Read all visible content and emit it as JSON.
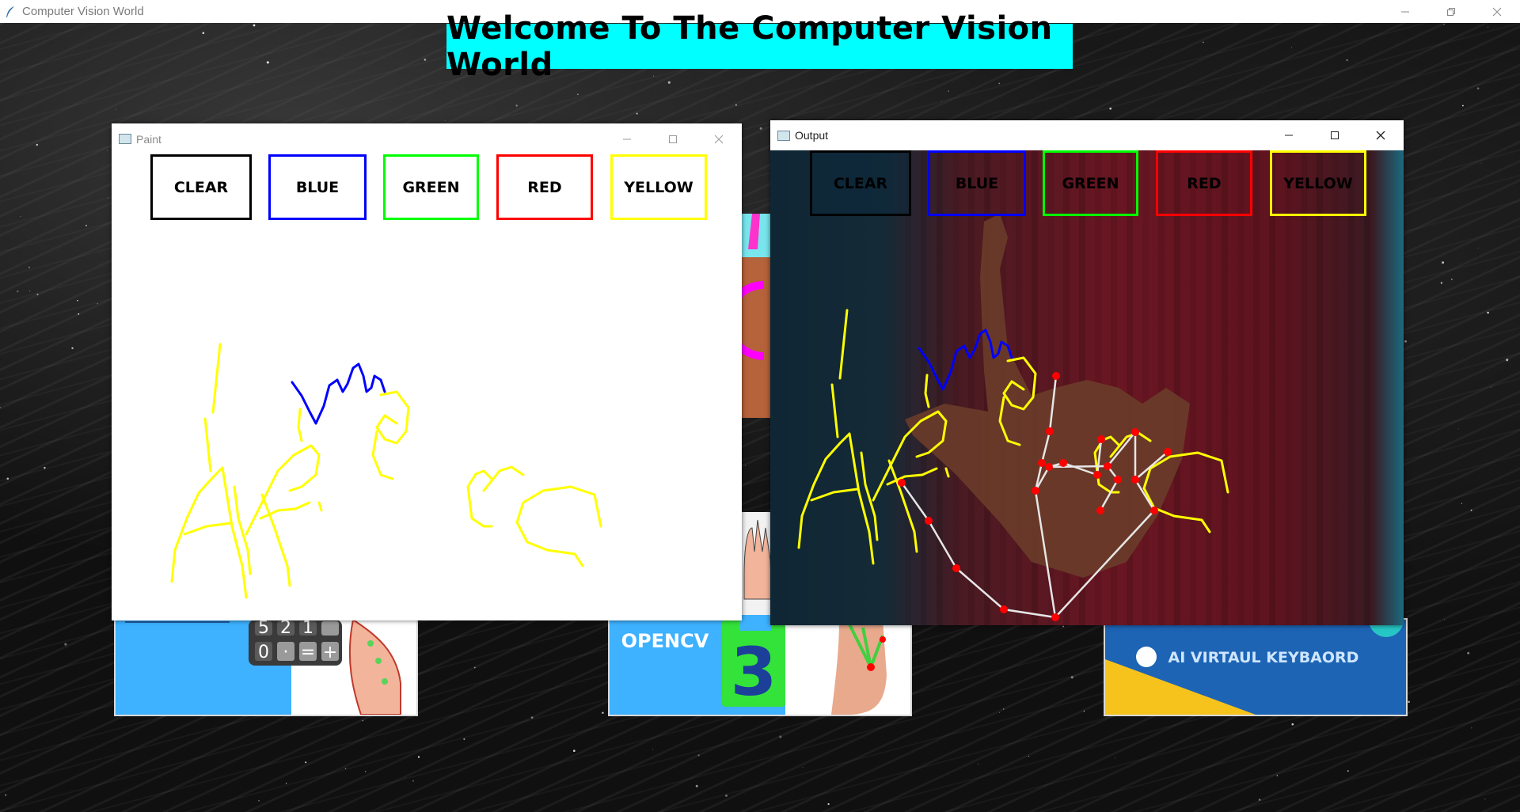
{
  "main_window": {
    "title": "Computer Vision World"
  },
  "banner": {
    "text": "Welcome To The Computer Vision World"
  },
  "paint_window": {
    "title": "Paint",
    "buttons": [
      {
        "label": "CLEAR",
        "color": "#000000"
      },
      {
        "label": "BLUE",
        "color": "#0000ff"
      },
      {
        "label": "GREEN",
        "color": "#00ff00"
      },
      {
        "label": "RED",
        "color": "#ff0000"
      },
      {
        "label": "YELLOW",
        "color": "#ffff00"
      }
    ]
  },
  "output_window": {
    "title": "Output",
    "buttons": [
      {
        "label": "CLEAR",
        "color": "#000000"
      },
      {
        "label": "BLUE",
        "color": "#0000ff"
      },
      {
        "label": "GREEN",
        "color": "#00ff00"
      },
      {
        "label": "RED",
        "color": "#ff0000"
      },
      {
        "label": "YELLOW",
        "color": "#ffff00"
      }
    ]
  },
  "background_cards": {
    "calculator_keys": [
      "5",
      "2",
      "1",
      "0",
      "·",
      "=",
      "+"
    ],
    "opencv_label": "OPENCV",
    "opencv_number": "3",
    "keyboard_label": "AI VIRTAUL KEYBAORD"
  },
  "colors": {
    "banner_bg": "#00ffff",
    "stroke_yellow": "#ffff00",
    "stroke_blue": "#0000ff",
    "landmark_red": "#ff0000",
    "landmark_line": "#e6e6e6"
  }
}
